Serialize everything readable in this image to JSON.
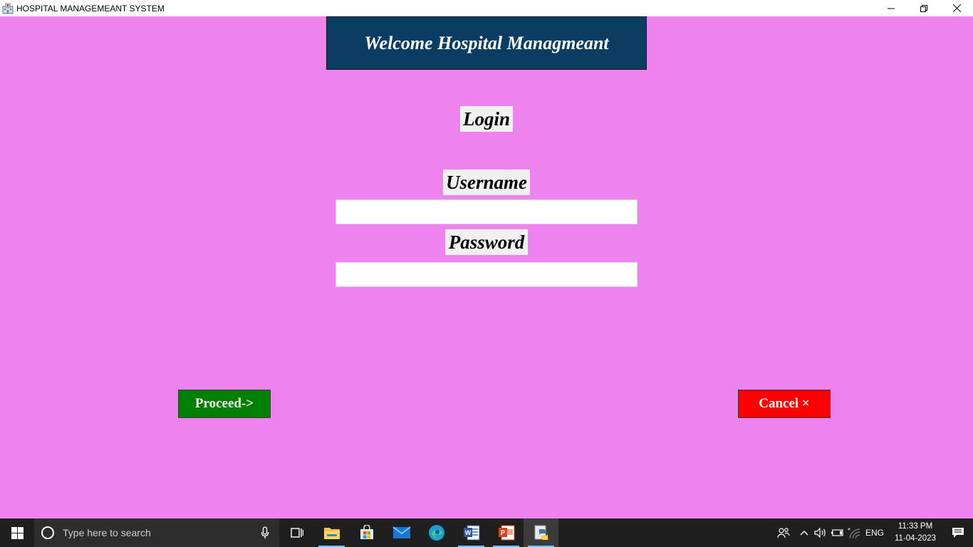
{
  "window": {
    "title": "HOSPITAL MANAGEMEANT SYSTEM",
    "app_icon": "hospital-icon",
    "controls": [
      "minimize-icon",
      "restore-icon",
      "close-icon"
    ]
  },
  "main": {
    "banner": "Welcome Hospital Managmeant",
    "login_label": "Login",
    "username_label": "Username",
    "username_value": "",
    "password_label": "Password",
    "password_value": "",
    "proceed_label": "Proceed->",
    "cancel_label": "Cancel ×"
  },
  "colors": {
    "background": "#ee82ee",
    "banner": "#0b3d63",
    "proceed": "#008000",
    "cancel": "#ff0000"
  },
  "taskbar": {
    "search_placeholder": "Type here to search",
    "apps": [
      "file-explorer-icon",
      "store-icon",
      "mail-icon",
      "edge-icon",
      "word-icon",
      "powerpoint-icon",
      "python-icon"
    ],
    "tray": {
      "language": "ENG",
      "time": "11:33 PM",
      "date": "11-04-2023"
    }
  }
}
